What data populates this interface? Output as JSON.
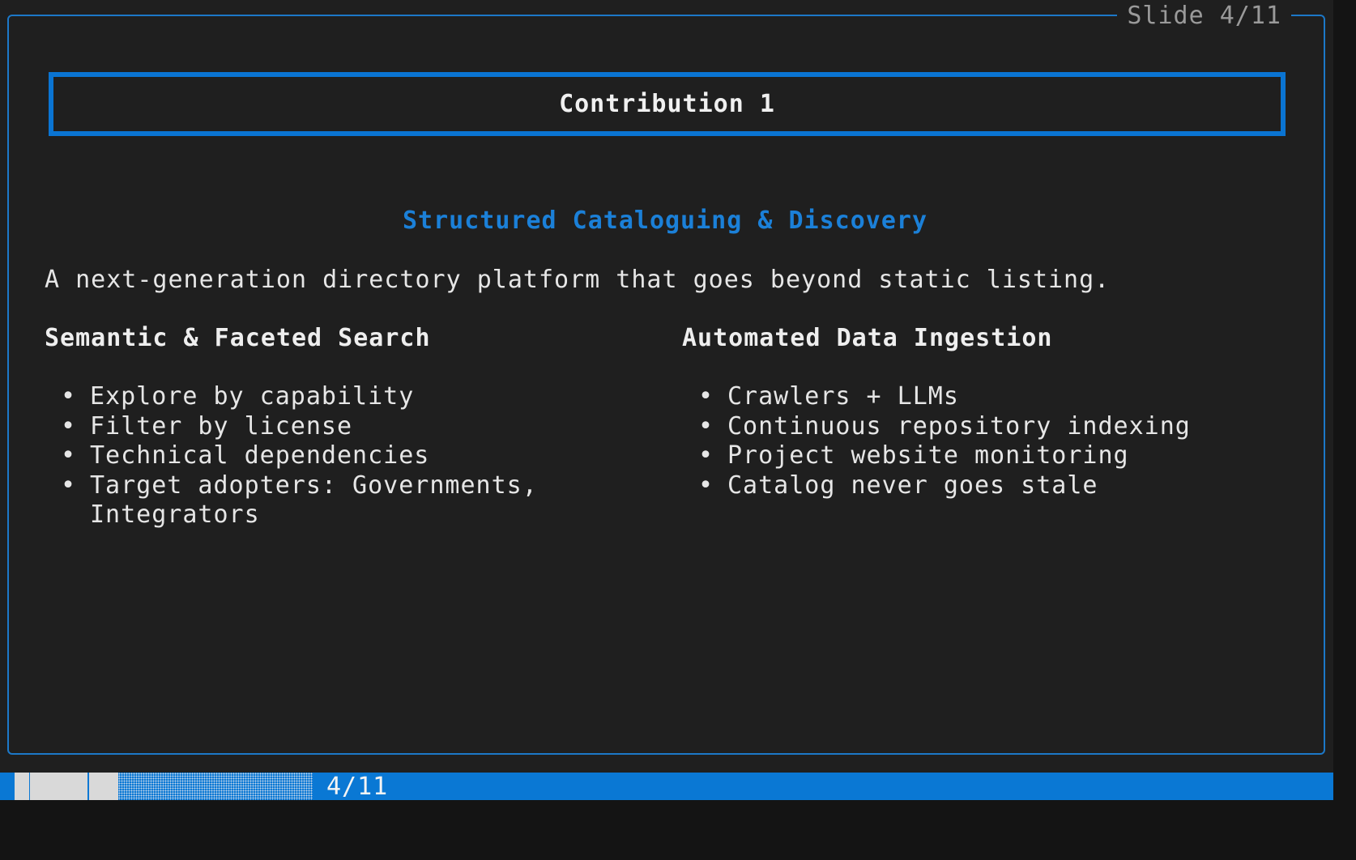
{
  "slide_counter": "Slide 4/11",
  "title": "Contribution 1",
  "subtitle": "Structured Cataloguing & Discovery",
  "intro": "A next-generation directory platform that goes beyond static listing.",
  "left_column": {
    "heading": "Semantic & Faceted Search",
    "items": [
      "Explore by capability",
      "Filter by license",
      "Technical dependencies",
      "Target adopters: Governments, Integrators"
    ]
  },
  "right_column": {
    "heading": "Automated Data Ingestion",
    "items": [
      "Crawlers + LLMs",
      "Continuous repository indexing",
      "Project website monitoring",
      "Catalog never goes stale"
    ]
  },
  "bullet_glyph": "•",
  "status_bar": {
    "progress_text": "4/11",
    "progress_fraction": 0.364
  },
  "colors": {
    "accent": "#0a74d2",
    "subtitle": "#1b80d8",
    "background": "#1f1f1f",
    "status_bar": "#0a78d4"
  }
}
